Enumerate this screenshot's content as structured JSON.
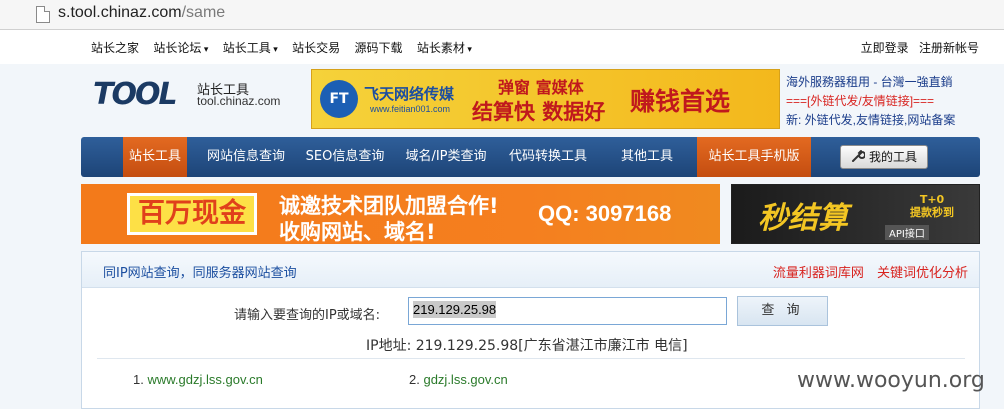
{
  "browser": {
    "url_host": "s.tool.chinaz.com",
    "url_path": "/same"
  },
  "topnav": {
    "links": [
      "站长之家",
      "站长论坛",
      "站长工具",
      "站长交易",
      "源码下载",
      "站长素材"
    ],
    "login": "立即登录",
    "register": "注册新帐号"
  },
  "logo": {
    "brand": "TOOL",
    "name_cn": "站长工具",
    "domain": "tool.chinaz.com"
  },
  "ad_top": {
    "brand_mark": "FT",
    "brand_name": "飞天网络传媒",
    "brand_url": "www.feitian001.com",
    "slogan_1": "弹窗 富媒体",
    "slogan_2": "结算快 数据好",
    "slogan_3": "赚钱首选"
  },
  "side_links": {
    "line1": "海外服務器租用 - 台灣一強直銷",
    "line2": "===[外链代发/友情链接]===",
    "line3": "新: 外链代发,友情链接,网站备案"
  },
  "menu": {
    "items": [
      "站长工具",
      "网站信息查询",
      "SEO信息查询",
      "域名/IP类查询",
      "代码转换工具",
      "其他工具",
      "站长工具手机版"
    ],
    "my_tools": "我的工具"
  },
  "ad_mid": {
    "badge": "百万现金",
    "line1": "诚邀技术团队加盟合作!",
    "line2": "收购网站、域名!",
    "qq": "QQ: 3097168"
  },
  "ad_right": {
    "big": "秒结算",
    "tag_1": "T+0",
    "tag_2": "提款秒到",
    "api": "API接口"
  },
  "panel": {
    "title": "同IP网站查询，同服务器网站查询",
    "right_links": [
      "流量利器词库网",
      "关键词优化分析"
    ],
    "query_label": "请输入要查询的IP或域名:",
    "query_value": "219.129.25.98",
    "query_button": "查 询",
    "ip_info": "IP地址: 219.129.25.98[广东省湛江市廉江市 电信]",
    "results": [
      {
        "index": "1.",
        "domain": "www.gdzj.lss.gov.cn"
      },
      {
        "index": "2.",
        "domain": "gdzj.lss.gov.cn"
      }
    ]
  },
  "watermark": "www.wooyun.org",
  "colors": {
    "menu_blue": "#1d4477",
    "highlight_orange": "#d85a18",
    "link_blue": "#1c4fa0",
    "link_red": "#d8231f"
  }
}
